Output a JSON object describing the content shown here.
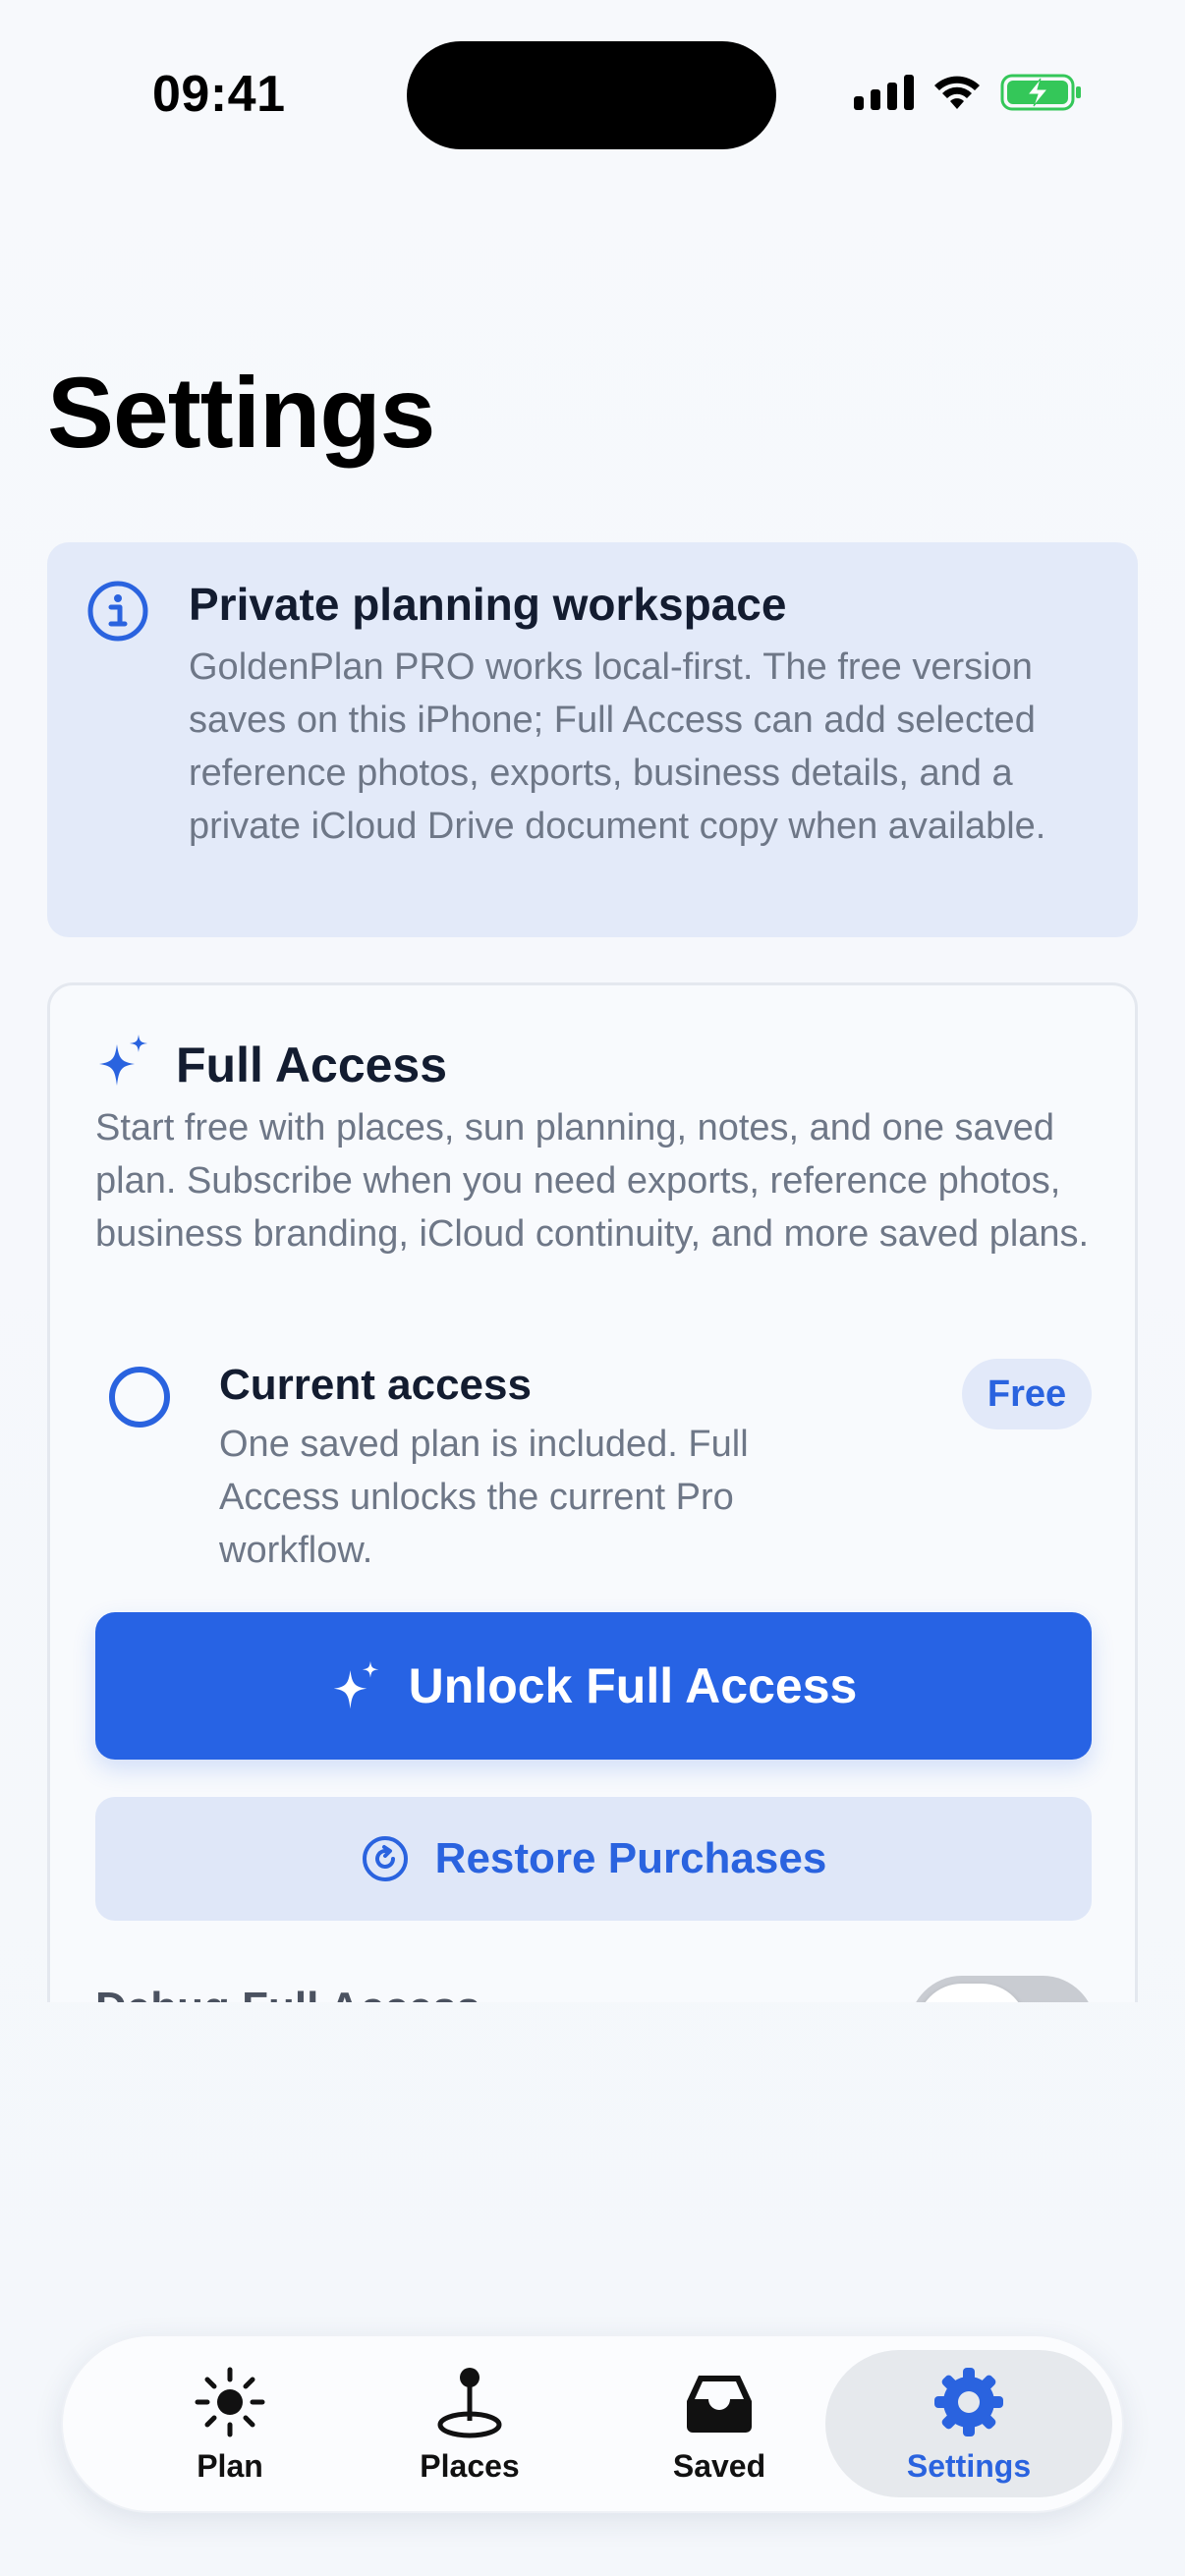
{
  "status_bar": {
    "time": "09:41"
  },
  "page": {
    "title": "Settings"
  },
  "info_card": {
    "icon": "info-icon",
    "title": "Private planning workspace",
    "body": "GoldenPlan PRO works local-first. The free version saves on this iPhone; Full Access can add selected reference photos, exports, business details, and a private iCloud Drive document copy when available."
  },
  "access_card": {
    "icon": "sparkle-icon",
    "title": "Full Access",
    "body": "Start free with places, sun planning, notes, and one saved plan. Subscribe when you need exports, reference photos, business branding, iCloud continuity, and more saved plans.",
    "current": {
      "title": "Current access",
      "body": "One saved plan is included. Full Access unlocks the current Pro workflow.",
      "badge": "Free"
    },
    "unlock_label": "Unlock Full Access",
    "restore_label": "Restore Purchases",
    "debug_label": "Debug Full Access",
    "debug_enabled": false
  },
  "tabbar": {
    "items": [
      {
        "label": "Plan",
        "icon": "sun-icon"
      },
      {
        "label": "Places",
        "icon": "map-pin-icon"
      },
      {
        "label": "Saved",
        "icon": "tray-icon"
      },
      {
        "label": "Settings",
        "icon": "gear-icon"
      }
    ],
    "selected": "Settings"
  },
  "colors": {
    "accent": "#2763e4",
    "info_bg": "#e3eaf9",
    "battery_fill": "#34c759"
  }
}
